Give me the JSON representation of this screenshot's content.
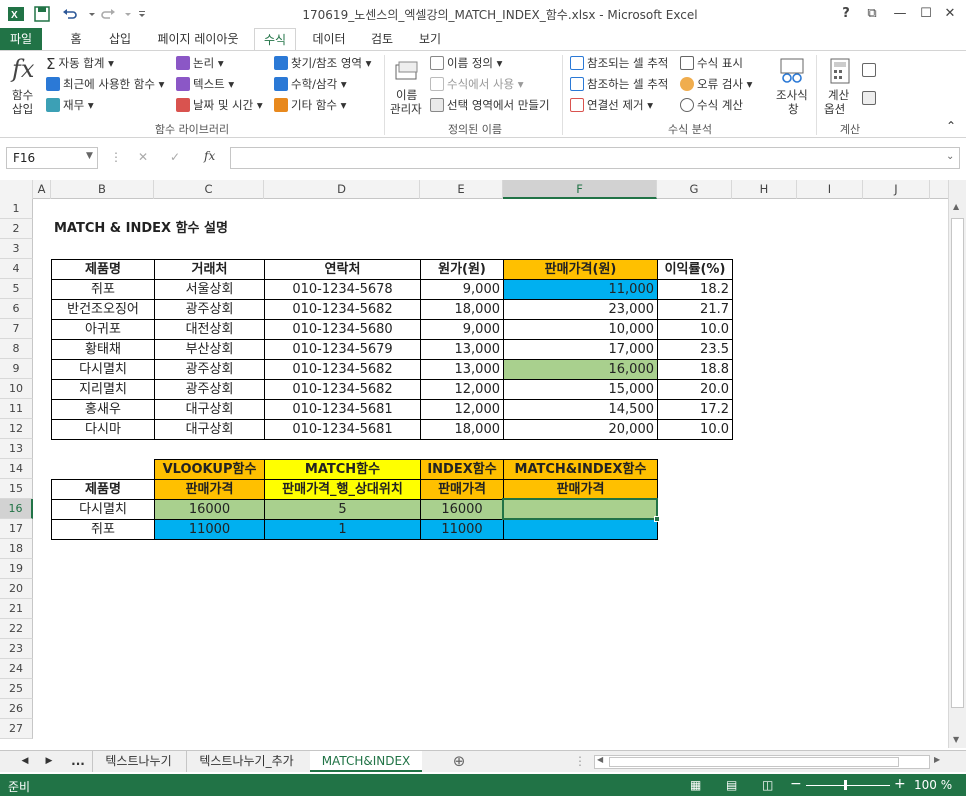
{
  "app": {
    "title": "170619_노센스의_엑셀강의_MATCH_INDEX_함수.xlsx - Microsoft Excel",
    "help": "?",
    "controls": {
      "restore": "⧉",
      "minimize": "—",
      "maximize": "☐",
      "close": "✕"
    }
  },
  "tabs": [
    "파일",
    "홈",
    "삽입",
    "페이지 레이아웃",
    "수식",
    "데이터",
    "검토",
    "보기"
  ],
  "ribbon": {
    "fx_label_1": "함수",
    "fx_label_2": "삽입",
    "lib": {
      "autosum": "자동 합계",
      "recent": "최근에 사용한 함수",
      "finance": "재무",
      "logic": "논리",
      "text": "텍스트",
      "datetime": "날짜 및 시간",
      "lookup": "찾기/참조 영역",
      "math": "수학/삼각",
      "more": "기타 함수",
      "group": "함수 라이브러리"
    },
    "names": {
      "manager_1": "이름",
      "manager_2": "관리자",
      "define": "이름 정의",
      "use": "수식에서 사용",
      "create": "선택 영역에서 만들기",
      "group": "정의된 이름"
    },
    "audit": {
      "precedents": "참조되는 셀 추적",
      "dependents": "참조하는 셀 추적",
      "remove": "연결선 제거",
      "show": "수식 표시",
      "errcheck": "오류 검사",
      "evaluate": "수식 계산",
      "watch_1": "조사식",
      "watch_2": "창",
      "group": "수식 분석"
    },
    "calc": {
      "opt_1": "계산",
      "opt_2": "옵션",
      "group": "계산"
    }
  },
  "formula_bar": {
    "namebox": "F16",
    "fx": "fx",
    "value": ""
  },
  "columns": [
    "A",
    "B",
    "C",
    "D",
    "E",
    "F",
    "G",
    "H",
    "I",
    "J"
  ],
  "rows": [
    "1",
    "2",
    "3",
    "4",
    "5",
    "6",
    "7",
    "8",
    "9",
    "10",
    "11",
    "12",
    "13",
    "14",
    "15",
    "16",
    "17",
    "18",
    "19",
    "20",
    "21",
    "22",
    "23",
    "24",
    "25",
    "26",
    "27"
  ],
  "sheet": {
    "title": "MATCH & INDEX 함수 설명",
    "headers": [
      "제품명",
      "거래처",
      "연락처",
      "원가(원)",
      "판매가격(원)",
      "이익률(%)"
    ],
    "table": [
      [
        "쥐포",
        "서울상회",
        "010-1234-5678",
        "9,000",
        "11,000",
        "18.2"
      ],
      [
        "반건조오징어",
        "광주상회",
        "010-1234-5682",
        "18,000",
        "23,000",
        "21.7"
      ],
      [
        "아귀포",
        "대전상회",
        "010-1234-5680",
        "9,000",
        "10,000",
        "10.0"
      ],
      [
        "황태채",
        "부산상회",
        "010-1234-5679",
        "13,000",
        "17,000",
        "23.5"
      ],
      [
        "다시멸치",
        "광주상회",
        "010-1234-5682",
        "13,000",
        "16,000",
        "18.8"
      ],
      [
        "지리멸치",
        "광주상회",
        "010-1234-5682",
        "12,000",
        "15,000",
        "20.0"
      ],
      [
        "홍새우",
        "대구상회",
        "010-1234-5681",
        "12,000",
        "14,500",
        "17.2"
      ],
      [
        "다시마",
        "대구상회",
        "010-1234-5681",
        "18,000",
        "20,000",
        "10.0"
      ]
    ],
    "lookup": {
      "top_headers": [
        "VLOOKUP함수",
        "MATCH함수",
        "INDEX함수",
        "MATCH&INDEX함수"
      ],
      "sub_label": "제품명",
      "sub_headers": [
        "판매가격",
        "판매가격_행_상대위치",
        "판매가격",
        "판매가격"
      ],
      "rows": [
        [
          "다시멸치",
          "16000",
          "5",
          "16000",
          ""
        ],
        [
          "쥐포",
          "11000",
          "1",
          "11000",
          ""
        ]
      ]
    }
  },
  "sheet_tabs": [
    "...",
    "텍스트나누기",
    "텍스트나누기_추가",
    "MATCH&INDEX"
  ],
  "status": {
    "mode": "준비",
    "zoom": "100 %"
  },
  "colors": {
    "excel_green": "#217346",
    "orange": "#ffc000",
    "yellow": "#ffff00",
    "blue": "#00b0f0",
    "green": "#a9d08e"
  }
}
